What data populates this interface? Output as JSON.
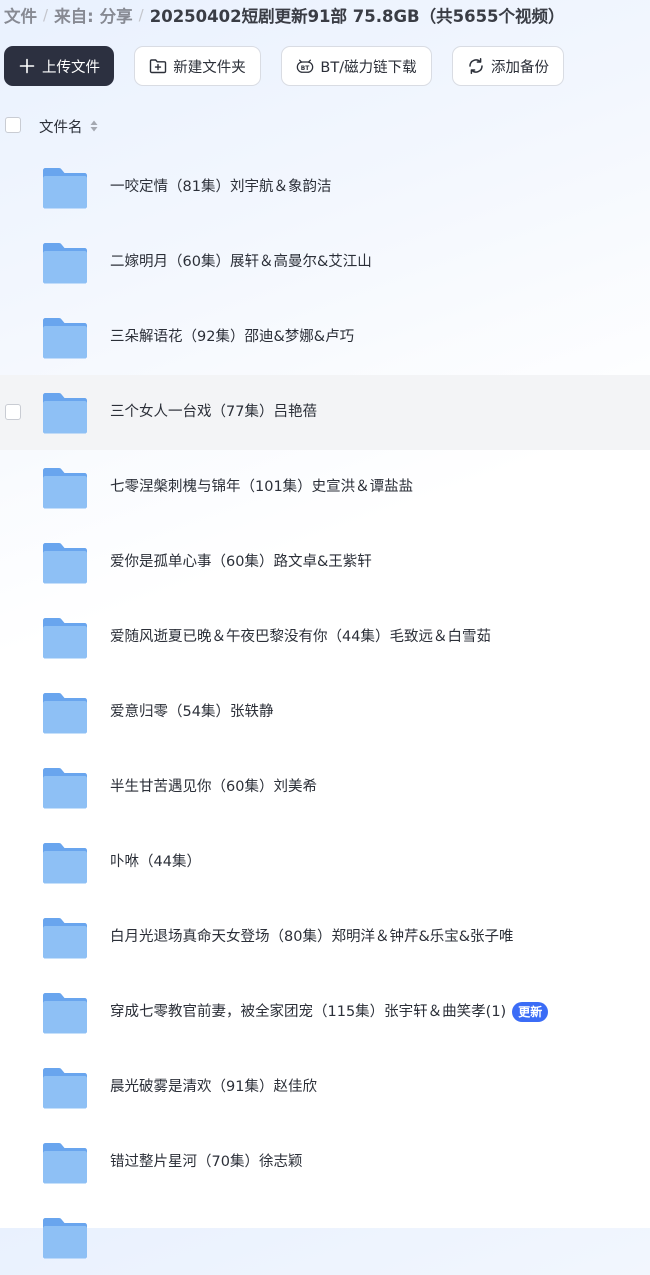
{
  "breadcrumb": {
    "root": "文件",
    "from": "来自:",
    "share": "分享",
    "current": "20250402短剧更新91部 75.8GB（共5655个视频）"
  },
  "toolbar": {
    "upload_label": "上传文件",
    "new_folder_label": "新建文件夹",
    "bt_label": "BT/磁力链下载",
    "backup_label": "添加备份"
  },
  "list_header": {
    "name_label": "文件名"
  },
  "files": [
    {
      "name": "一咬定情（81集）刘宇航＆象韵洁",
      "badge": ""
    },
    {
      "name": "二嫁明月（60集）展轩＆高曼尔&艾江山",
      "badge": ""
    },
    {
      "name": "三朵解语花（92集）邵迪&梦娜&卢巧",
      "badge": ""
    },
    {
      "name": "三个女人一台戏（77集）吕艳蓓",
      "badge": ""
    },
    {
      "name": "七零涅槃刺槐与锦年（101集）史宣洪＆谭盐盐",
      "badge": ""
    },
    {
      "name": "爱你是孤单心事（60集）路文卓&王紫轩",
      "badge": ""
    },
    {
      "name": "爱随风逝夏已晚＆午夜巴黎没有你（44集）毛致远＆白雪茹",
      "badge": ""
    },
    {
      "name": "爱意归零（54集）张轶静",
      "badge": ""
    },
    {
      "name": "半生甘苦遇见你（60集）刘美希",
      "badge": ""
    },
    {
      "name": "卟咻（44集）",
      "badge": ""
    },
    {
      "name": "白月光退场真命天女登场（80集）郑明洋＆钟芹&乐宝&张子唯",
      "badge": ""
    },
    {
      "name": "穿成七零教官前妻，被全家团宠（115集）张宇轩＆曲笑孝(1)",
      "badge": "更新"
    },
    {
      "name": "晨光破雾是清欢（91集）赵佳欣",
      "badge": ""
    },
    {
      "name": "错过整片星河（70集）徐志颖",
      "badge": ""
    },
    {
      "name": "",
      "badge": ""
    }
  ],
  "colors": {
    "primary_button": "#2c3040",
    "folder_blue": "#7fb6f2",
    "badge_blue": "#3b6cf6",
    "hover_row": "#f3f4f6"
  },
  "icons": {
    "upload": "plus-icon",
    "new_folder": "folder-plus-icon",
    "bt": "bt-icon",
    "backup": "sync-icon",
    "sort": "sort-icon",
    "file": "folder-icon"
  }
}
